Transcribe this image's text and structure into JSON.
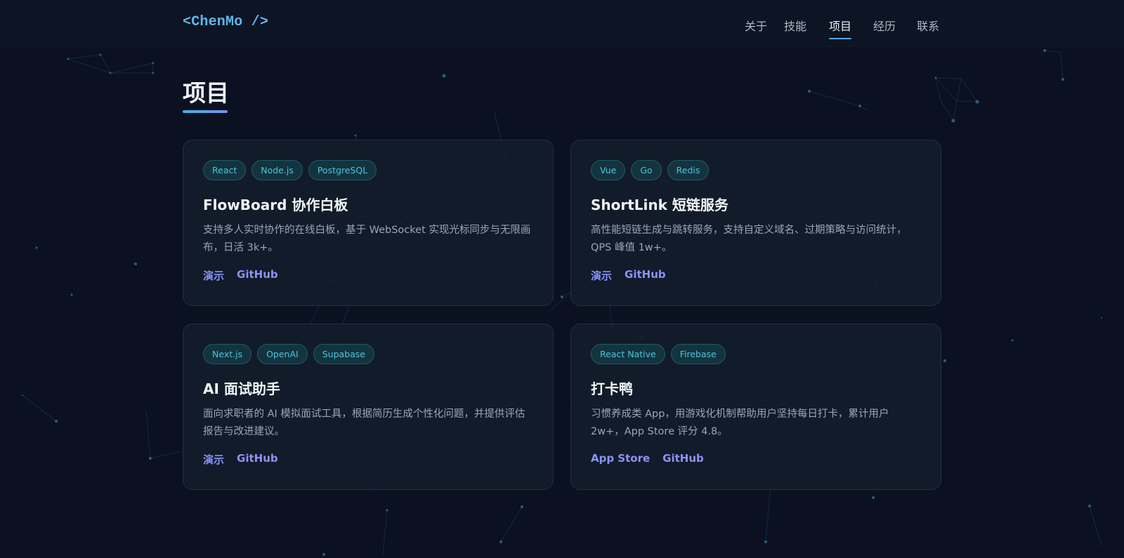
{
  "header": {
    "logo": "<ChenMo />",
    "nav": [
      {
        "label": "关于"
      },
      {
        "label": "技能"
      },
      {
        "label": "项目"
      },
      {
        "label": "经历"
      },
      {
        "label": "联系"
      }
    ],
    "active_nav": "项目"
  },
  "section": {
    "title": "项目"
  },
  "projects": [
    {
      "tags": [
        "React",
        "Node.js",
        "PostgreSQL"
      ],
      "title": "FlowBoard 协作白板",
      "description": "支持多人实时协作的在线白板，基于 WebSocket 实现光标同步与无限画布，日活 3k+。",
      "links": [
        "演示",
        "GitHub"
      ]
    },
    {
      "tags": [
        "Vue",
        "Go",
        "Redis"
      ],
      "title": "ShortLink 短链服务",
      "description": "高性能短链生成与跳转服务，支持自定义域名、过期策略与访问统计，QPS 峰值 1w+。",
      "links": [
        "演示",
        "GitHub"
      ]
    },
    {
      "tags": [
        "Next.js",
        "OpenAI",
        "Supabase"
      ],
      "title": "AI 面试助手",
      "description": "面向求职者的 AI 模拟面试工具，根据简历生成个性化问题，并提供评估报告与改进建议。",
      "links": [
        "演示",
        "GitHub"
      ]
    },
    {
      "tags": [
        "React Native",
        "Firebase"
      ],
      "title": "打卡鸭",
      "description": "习惯养成类 App，用游戏化机制帮助用户坚持每日打卡，累计用户 2w+，App Store 评分 4.8。",
      "links": [
        "App Store",
        "GitHub"
      ]
    }
  ],
  "colors": {
    "background": "#0b1120",
    "card": "#141c2a",
    "accent_link": "#8a93f5",
    "tag_text": "#4cc3dd",
    "logo": "#5fb7ee",
    "underline_start": "#3bb4e0",
    "underline_end": "#7c8cf0"
  }
}
